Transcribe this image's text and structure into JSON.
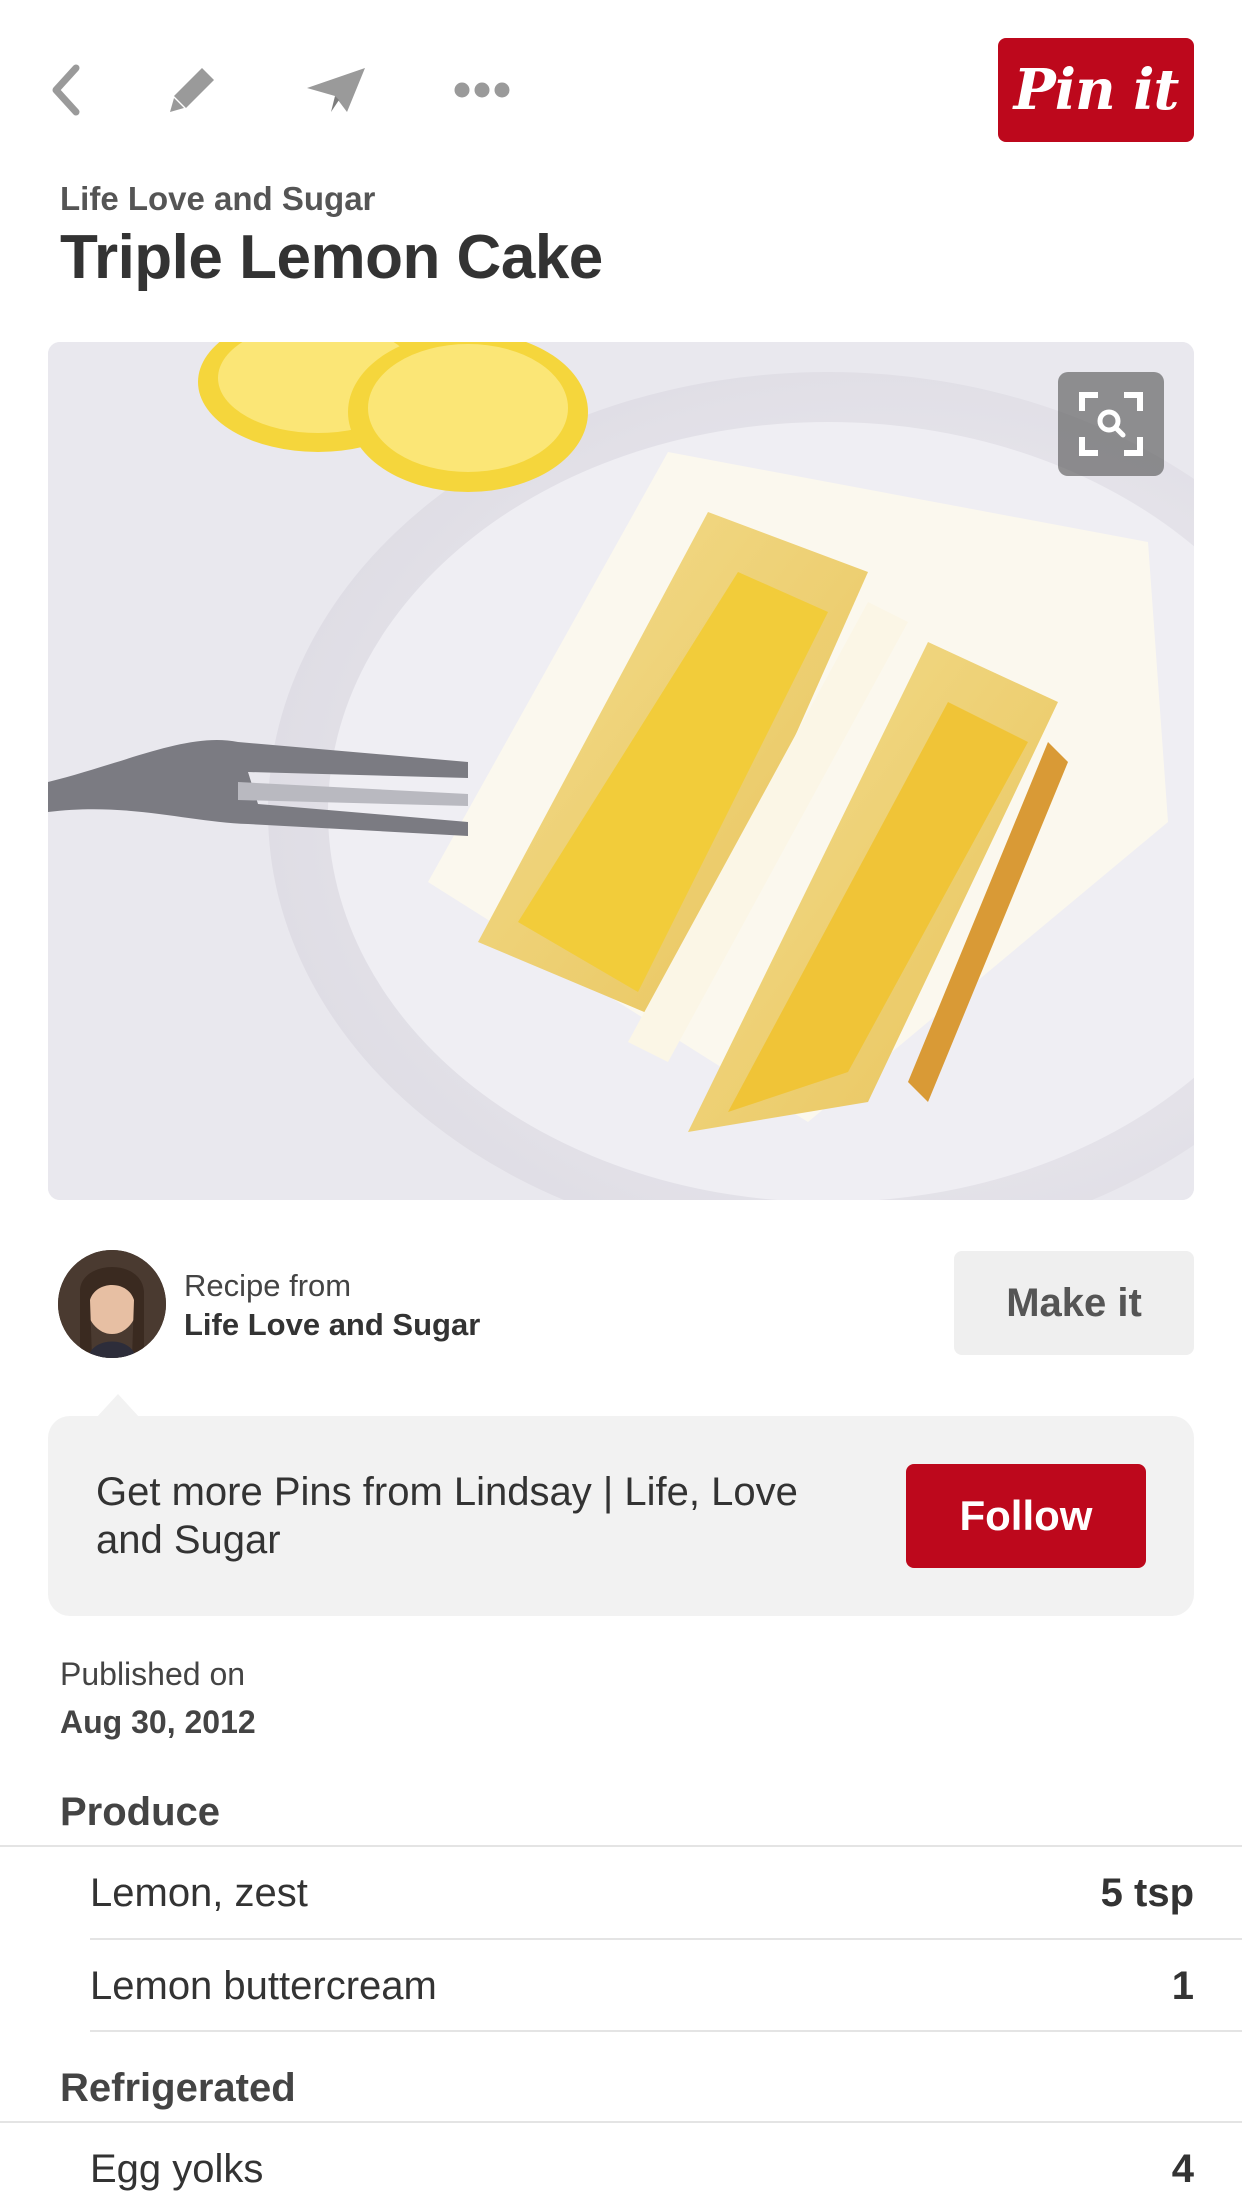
{
  "toolbar": {
    "back_icon": "chevron-left-icon",
    "edit_icon": "pencil-icon",
    "send_icon": "paper-plane-icon",
    "more_icon": "more-dots-icon",
    "pin_it_label": "Pin it",
    "icon_color": "#9a9a9a"
  },
  "header": {
    "source": "Life Love and Sugar",
    "title": "Triple Lemon Cake"
  },
  "image": {
    "subject": "slice of triple lemon layer cake on a plate with fork and lemon slices",
    "zoom_icon": "visual-search-icon"
  },
  "recipe": {
    "from_label": "Recipe from",
    "from_name": "Life Love and Sugar",
    "make_it_label": "Make it"
  },
  "follow_card": {
    "text": "Get more Pins from Lindsay | Life, Love and Sugar",
    "follow_label": "Follow"
  },
  "published": {
    "label": "Published on",
    "date": "Aug 30, 2012"
  },
  "ingredients": [
    {
      "section": "Produce",
      "items": [
        {
          "name": "Lemon, zest",
          "qty": "5 tsp"
        },
        {
          "name": "Lemon buttercream",
          "qty": "1"
        }
      ]
    },
    {
      "section": "Refrigerated",
      "items": [
        {
          "name": "Egg yolks",
          "qty": "4"
        }
      ]
    }
  ],
  "colors": {
    "brand_red": "#bd081c",
    "card_gray": "#f2f2f2",
    "button_gray": "#efefef"
  }
}
